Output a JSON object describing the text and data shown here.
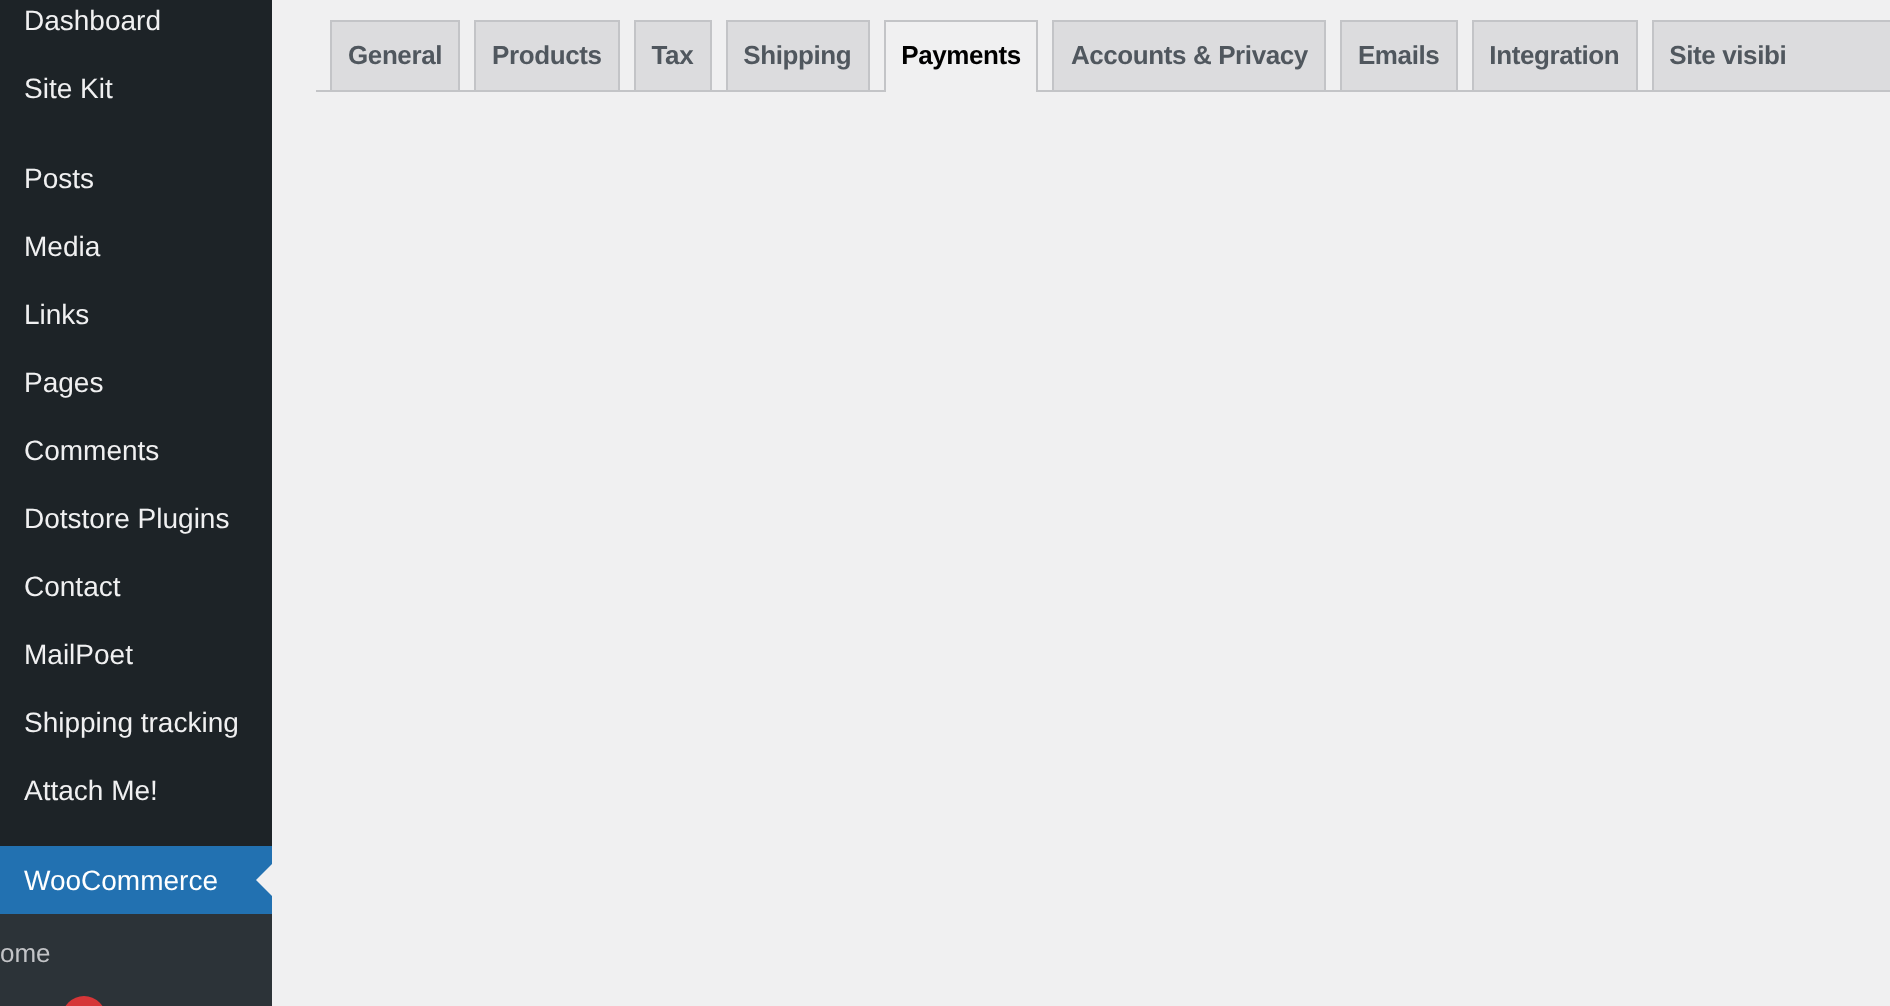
{
  "sidebar": {
    "items": [
      {
        "label": "Dashboard",
        "selected": false
      },
      {
        "label": "Site Kit",
        "selected": false
      },
      {
        "label": "Posts",
        "selected": false
      },
      {
        "label": "Media",
        "selected": false
      },
      {
        "label": "Links",
        "selected": false
      },
      {
        "label": "Pages",
        "selected": false
      },
      {
        "label": "Comments",
        "selected": false
      },
      {
        "label": "Dotstore Plugins",
        "selected": false
      },
      {
        "label": "Contact",
        "selected": false
      },
      {
        "label": "MailPoet",
        "selected": false
      },
      {
        "label": "Shipping tracking",
        "selected": false
      },
      {
        "label": "Attach Me!",
        "selected": false
      },
      {
        "label": "WooCommerce",
        "selected": true
      }
    ],
    "submenu": [
      {
        "label": "ome"
      }
    ]
  },
  "tabs": [
    {
      "label": "General",
      "selected": false
    },
    {
      "label": "Products",
      "selected": false
    },
    {
      "label": "Tax",
      "selected": false
    },
    {
      "label": "Shipping",
      "selected": false
    },
    {
      "label": "Payments",
      "selected": true
    },
    {
      "label": "Accounts & Privacy",
      "selected": false
    },
    {
      "label": "Emails",
      "selected": false
    },
    {
      "label": "Integration",
      "selected": false
    },
    {
      "label": "Site visibi",
      "selected": false
    }
  ]
}
